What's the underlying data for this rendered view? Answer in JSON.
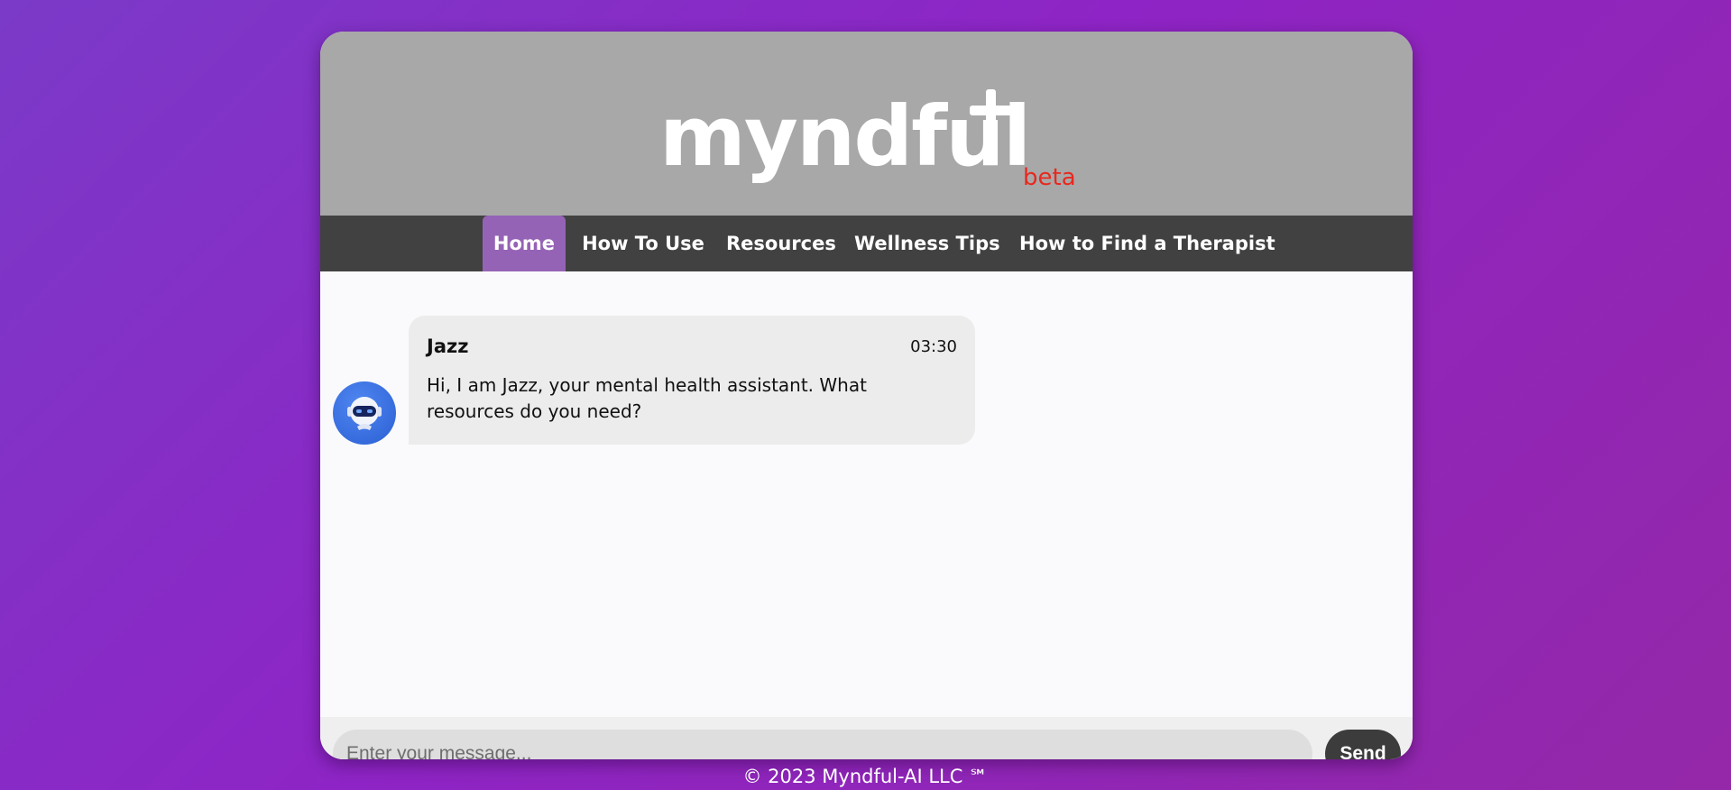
{
  "header": {
    "logo_text": "myndful",
    "logo_badge": "beta"
  },
  "nav": {
    "items": [
      {
        "label": "Home",
        "active": true
      },
      {
        "label": "How To Use",
        "active": false
      },
      {
        "label": "Resources",
        "active": false
      },
      {
        "label": "Wellness Tips",
        "active": false
      },
      {
        "label": "How to Find a Therapist",
        "active": false
      }
    ]
  },
  "chat": {
    "messages": [
      {
        "sender": "Jazz",
        "time": "03:30",
        "text": "Hi, I am Jazz, your mental health assistant. What resources do you need?",
        "avatar_icon": "robot-icon"
      }
    ]
  },
  "composer": {
    "placeholder": "Enter your message...",
    "value": "",
    "send_label": "Send"
  },
  "footer": {
    "text": "© 2023 Myndful-AI LLC ℠"
  },
  "colors": {
    "background_start": "#7b3ac8",
    "background_end": "#9428a8",
    "header": "#a8a8a8",
    "nav": "#414141",
    "nav_active": "#9563b5",
    "beta": "#e8281e",
    "send_button": "#3c3c3c",
    "bubble": "#ececec"
  }
}
